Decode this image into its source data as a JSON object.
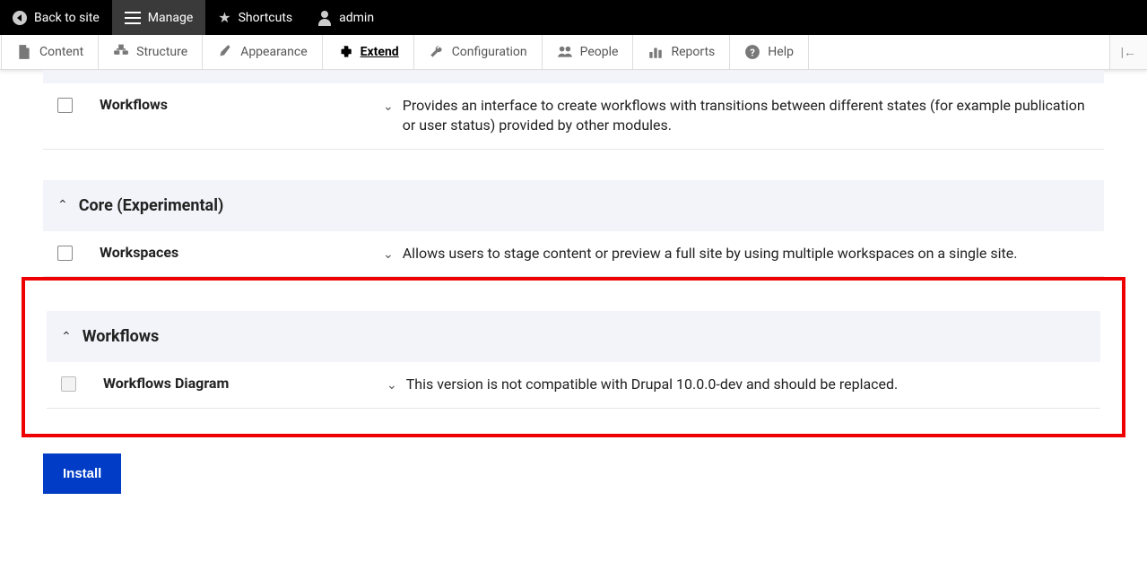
{
  "toolbar": {
    "back": "Back to site",
    "manage": "Manage",
    "shortcuts": "Shortcuts",
    "user": "admin"
  },
  "admin_menu": {
    "content": "Content",
    "structure": "Structure",
    "appearance": "Appearance",
    "extend": "Extend",
    "configuration": "Configuration",
    "people": "People",
    "reports": "Reports",
    "help": "Help"
  },
  "modules": {
    "workflows": {
      "name": "Workflows",
      "desc": "Provides an interface to create workflows with transitions between different states (for example publication or user status) provided by other modules."
    },
    "workspaces": {
      "name": "Workspaces",
      "desc": "Allows users to stage content or preview a full site by using multiple workspaces on a single site."
    },
    "workflows_diagram": {
      "name": "Workflows Diagram",
      "desc": "This version is not compatible with Drupal 10.0.0-dev and should be replaced."
    }
  },
  "sections": {
    "core_experimental": "Core (Experimental)",
    "workflows": "Workflows"
  },
  "buttons": {
    "install": "Install"
  }
}
